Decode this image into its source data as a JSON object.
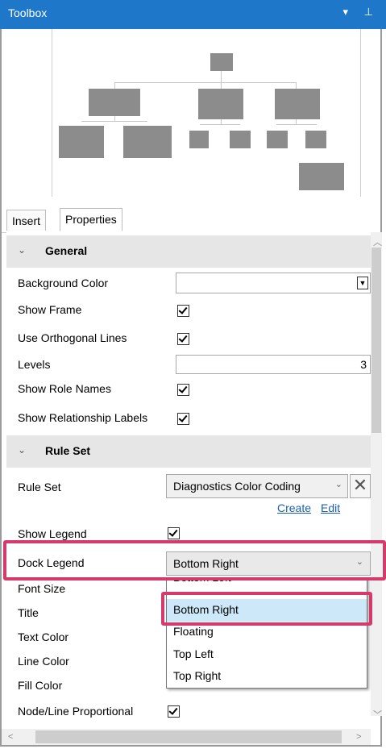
{
  "titlebar": {
    "title": "Toolbox",
    "pin_glyph": "▾ 📌"
  },
  "tabs": [
    {
      "label": "Insert"
    },
    {
      "label": "Properties"
    }
  ],
  "sections": {
    "general": "General",
    "rule_set": "Rule Set"
  },
  "general": {
    "background_color": "Background Color",
    "show_frame": "Show Frame",
    "use_orthogonal_lines": "Use Orthogonal Lines",
    "levels": "Levels",
    "levels_value": "3",
    "show_role_names": "Show Role Names",
    "show_relationship_labels": "Show Relationship Labels"
  },
  "rule_set": {
    "label": "Rule Set",
    "value": "Diagnostics Color Coding",
    "create": "Create",
    "edit": "Edit",
    "show_legend": "Show Legend",
    "dock_legend": "Dock Legend",
    "dock_legend_value": "Bottom Right",
    "font_size": "Font Size",
    "title": "Title",
    "text_color": "Text Color",
    "line_color": "Line Color",
    "fill_color": "Fill Color",
    "node_line_proportional": "Node/Line Proportional"
  },
  "dock_options": [
    "Bottom Left",
    "Bottom Right",
    "Floating",
    "Top Left",
    "Top Right"
  ],
  "colors": {
    "titlebar": "#1f77c9",
    "highlight": "#d63a6a",
    "selected_option": "#cde8f8"
  }
}
